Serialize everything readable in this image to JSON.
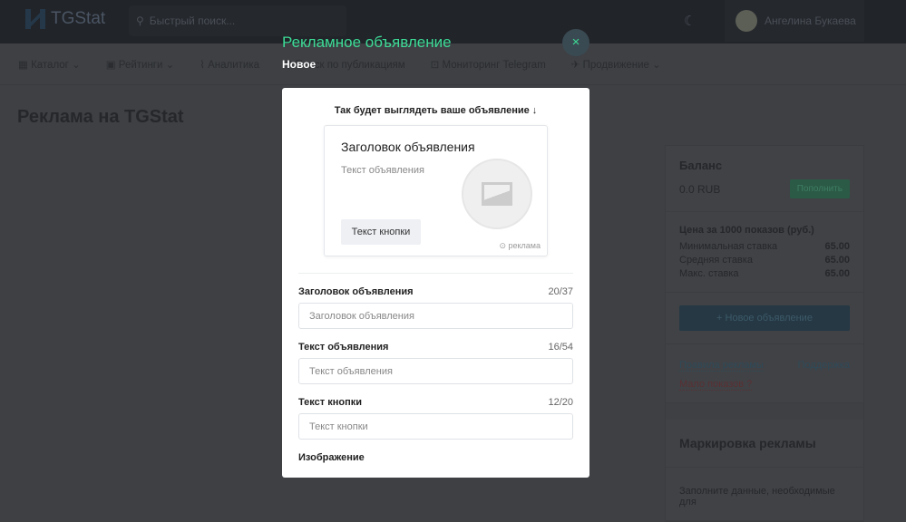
{
  "header": {
    "brand": "TGStat",
    "search_placeholder": "Быстрый поиск...",
    "user_name": "Ангелина Букаева"
  },
  "nav": [
    "Каталог",
    "Рейтинги",
    "Аналитика",
    "Поиск по публикациям",
    "Мониторинг Telegram",
    "Продвижение"
  ],
  "page_title": "Реклама на TGStat",
  "sidebar": {
    "balance_title": "Баланс",
    "balance": "0.0 RUB",
    "topup": "Пополнить",
    "price_title": "Цена за 1000 показов (руб.)",
    "rates": [
      {
        "label": "Минимальная ставка",
        "value": "65.00"
      },
      {
        "label": "Средняя ставка",
        "value": "65.00"
      },
      {
        "label": "Макс. ставка",
        "value": "65.00"
      }
    ],
    "new_ad": "+ Новое объявление",
    "rules": "Правила рекламы",
    "support": "Поддержка",
    "few_views": "Мало показов ?",
    "marking_title": "Маркировка рекламы",
    "marking_text": "Заполните данные, необходимые для"
  },
  "modal": {
    "title": "Рекламное объявление",
    "subtitle": "Новое",
    "close": "×",
    "preview_label": "Так будет выглядеть ваше объявление ↓",
    "preview": {
      "title": "Заголовок объявления",
      "text": "Текст объявления",
      "button": "Текст кнопки",
      "ad": "⊙ реклама"
    },
    "fields": [
      {
        "label": "Заголовок объявления",
        "count": "20/37",
        "placeholder": "Заголовок объявления"
      },
      {
        "label": "Текст объявления",
        "count": "16/54",
        "placeholder": "Текст объявления"
      },
      {
        "label": "Текст кнопки",
        "count": "12/20",
        "placeholder": "Текст кнопки"
      }
    ],
    "image_label": "Изображение"
  }
}
